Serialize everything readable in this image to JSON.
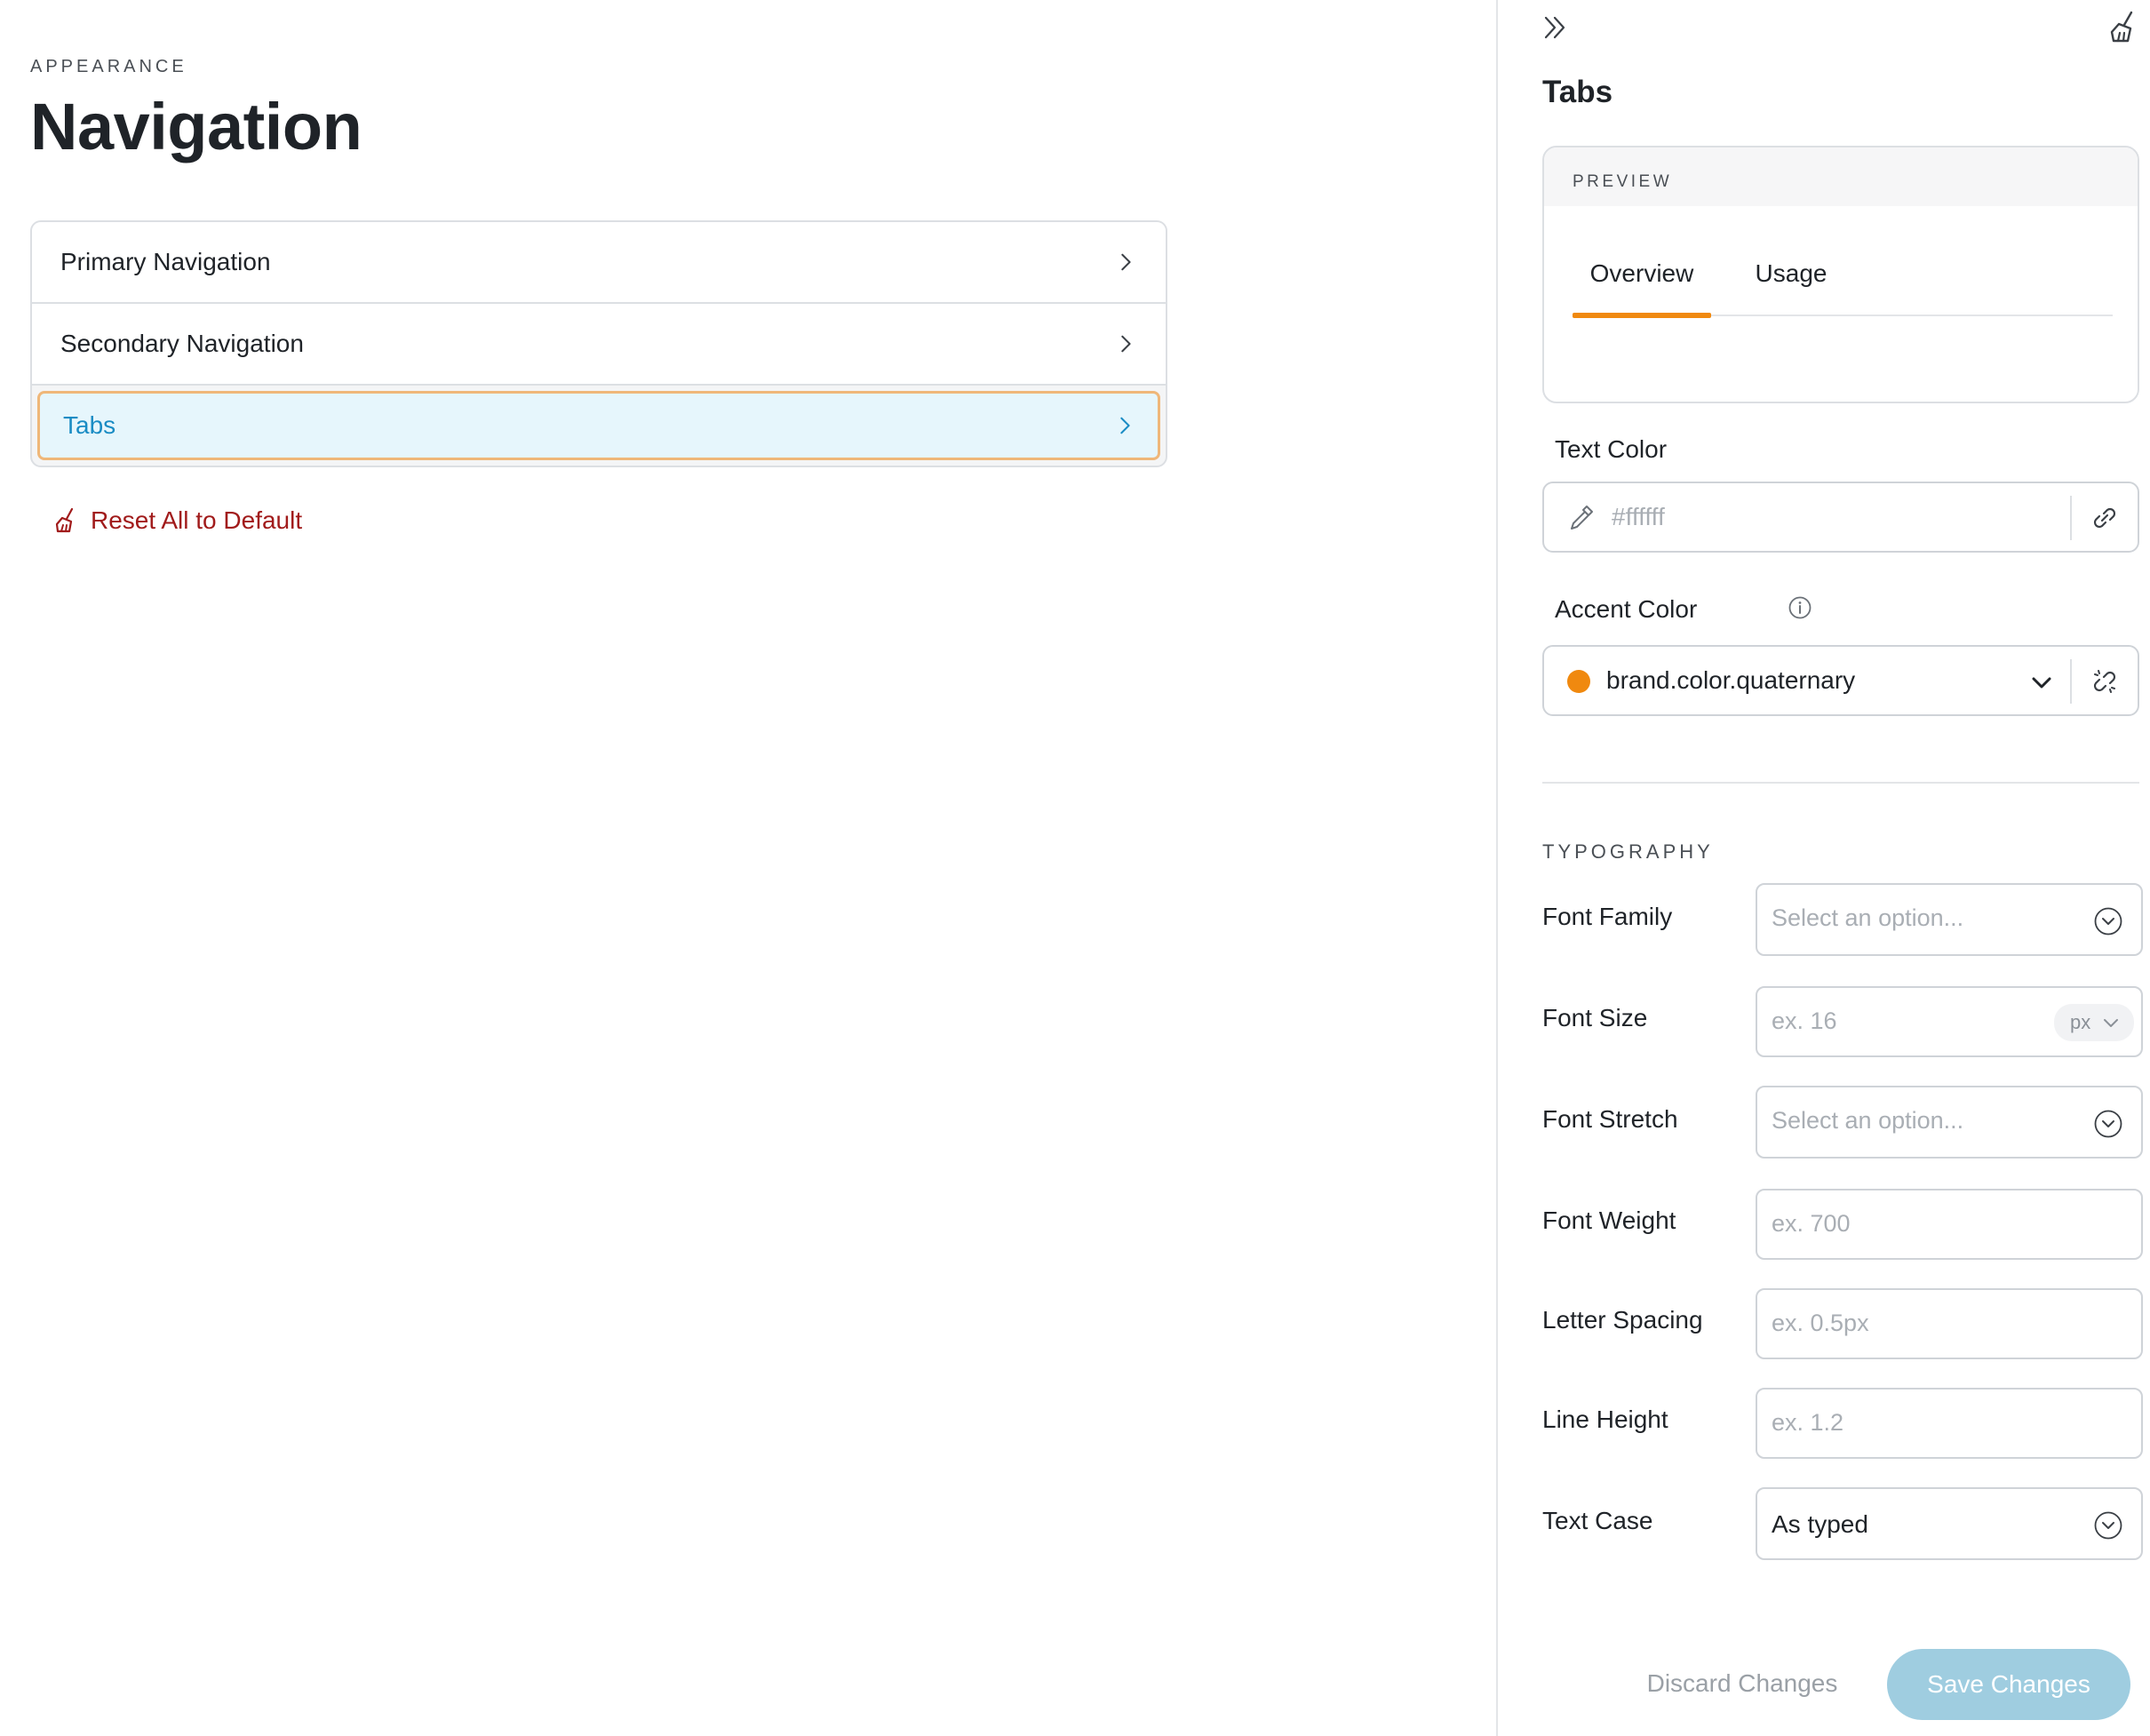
{
  "left": {
    "eyebrow": "APPEARANCE",
    "title": "Navigation",
    "items": [
      {
        "label": "Primary Navigation"
      },
      {
        "label": "Secondary Navigation"
      },
      {
        "label": "Tabs",
        "active": true
      }
    ],
    "reset_label": "Reset All to Default"
  },
  "panel": {
    "title": "Tabs",
    "preview": {
      "label": "PREVIEW",
      "tabs": [
        {
          "label": "Overview",
          "selected": true
        },
        {
          "label": "Usage"
        }
      ]
    },
    "text_color": {
      "label": "Text Color",
      "placeholder": "#ffffff",
      "value": ""
    },
    "accent_color": {
      "label": "Accent Color",
      "value": "brand.color.quaternary",
      "swatch": "#f0890f"
    },
    "typography": {
      "heading": "TYPOGRAPHY",
      "font_family": {
        "label": "Font Family",
        "placeholder": "Select an option..."
      },
      "font_size": {
        "label": "Font Size",
        "placeholder": "ex. 16",
        "unit": "px"
      },
      "font_stretch": {
        "label": "Font Stretch",
        "placeholder": "Select an option..."
      },
      "font_weight": {
        "label": "Font Weight",
        "placeholder": "ex. 700"
      },
      "letter_spacing": {
        "label": "Letter Spacing",
        "placeholder": "ex. 0.5px"
      },
      "line_height": {
        "label": "Line Height",
        "placeholder": "ex. 1.2"
      },
      "text_case": {
        "label": "Text Case",
        "value": "As typed"
      }
    },
    "discard_label": "Discard Changes",
    "save_label": "Save Changes"
  },
  "colors": {
    "accent": "#f0890f",
    "active_text": "#1a8cc4",
    "active_bg": "#e6f6fc",
    "danger": "#a11b1b",
    "save_bg": "#9fcde0"
  }
}
